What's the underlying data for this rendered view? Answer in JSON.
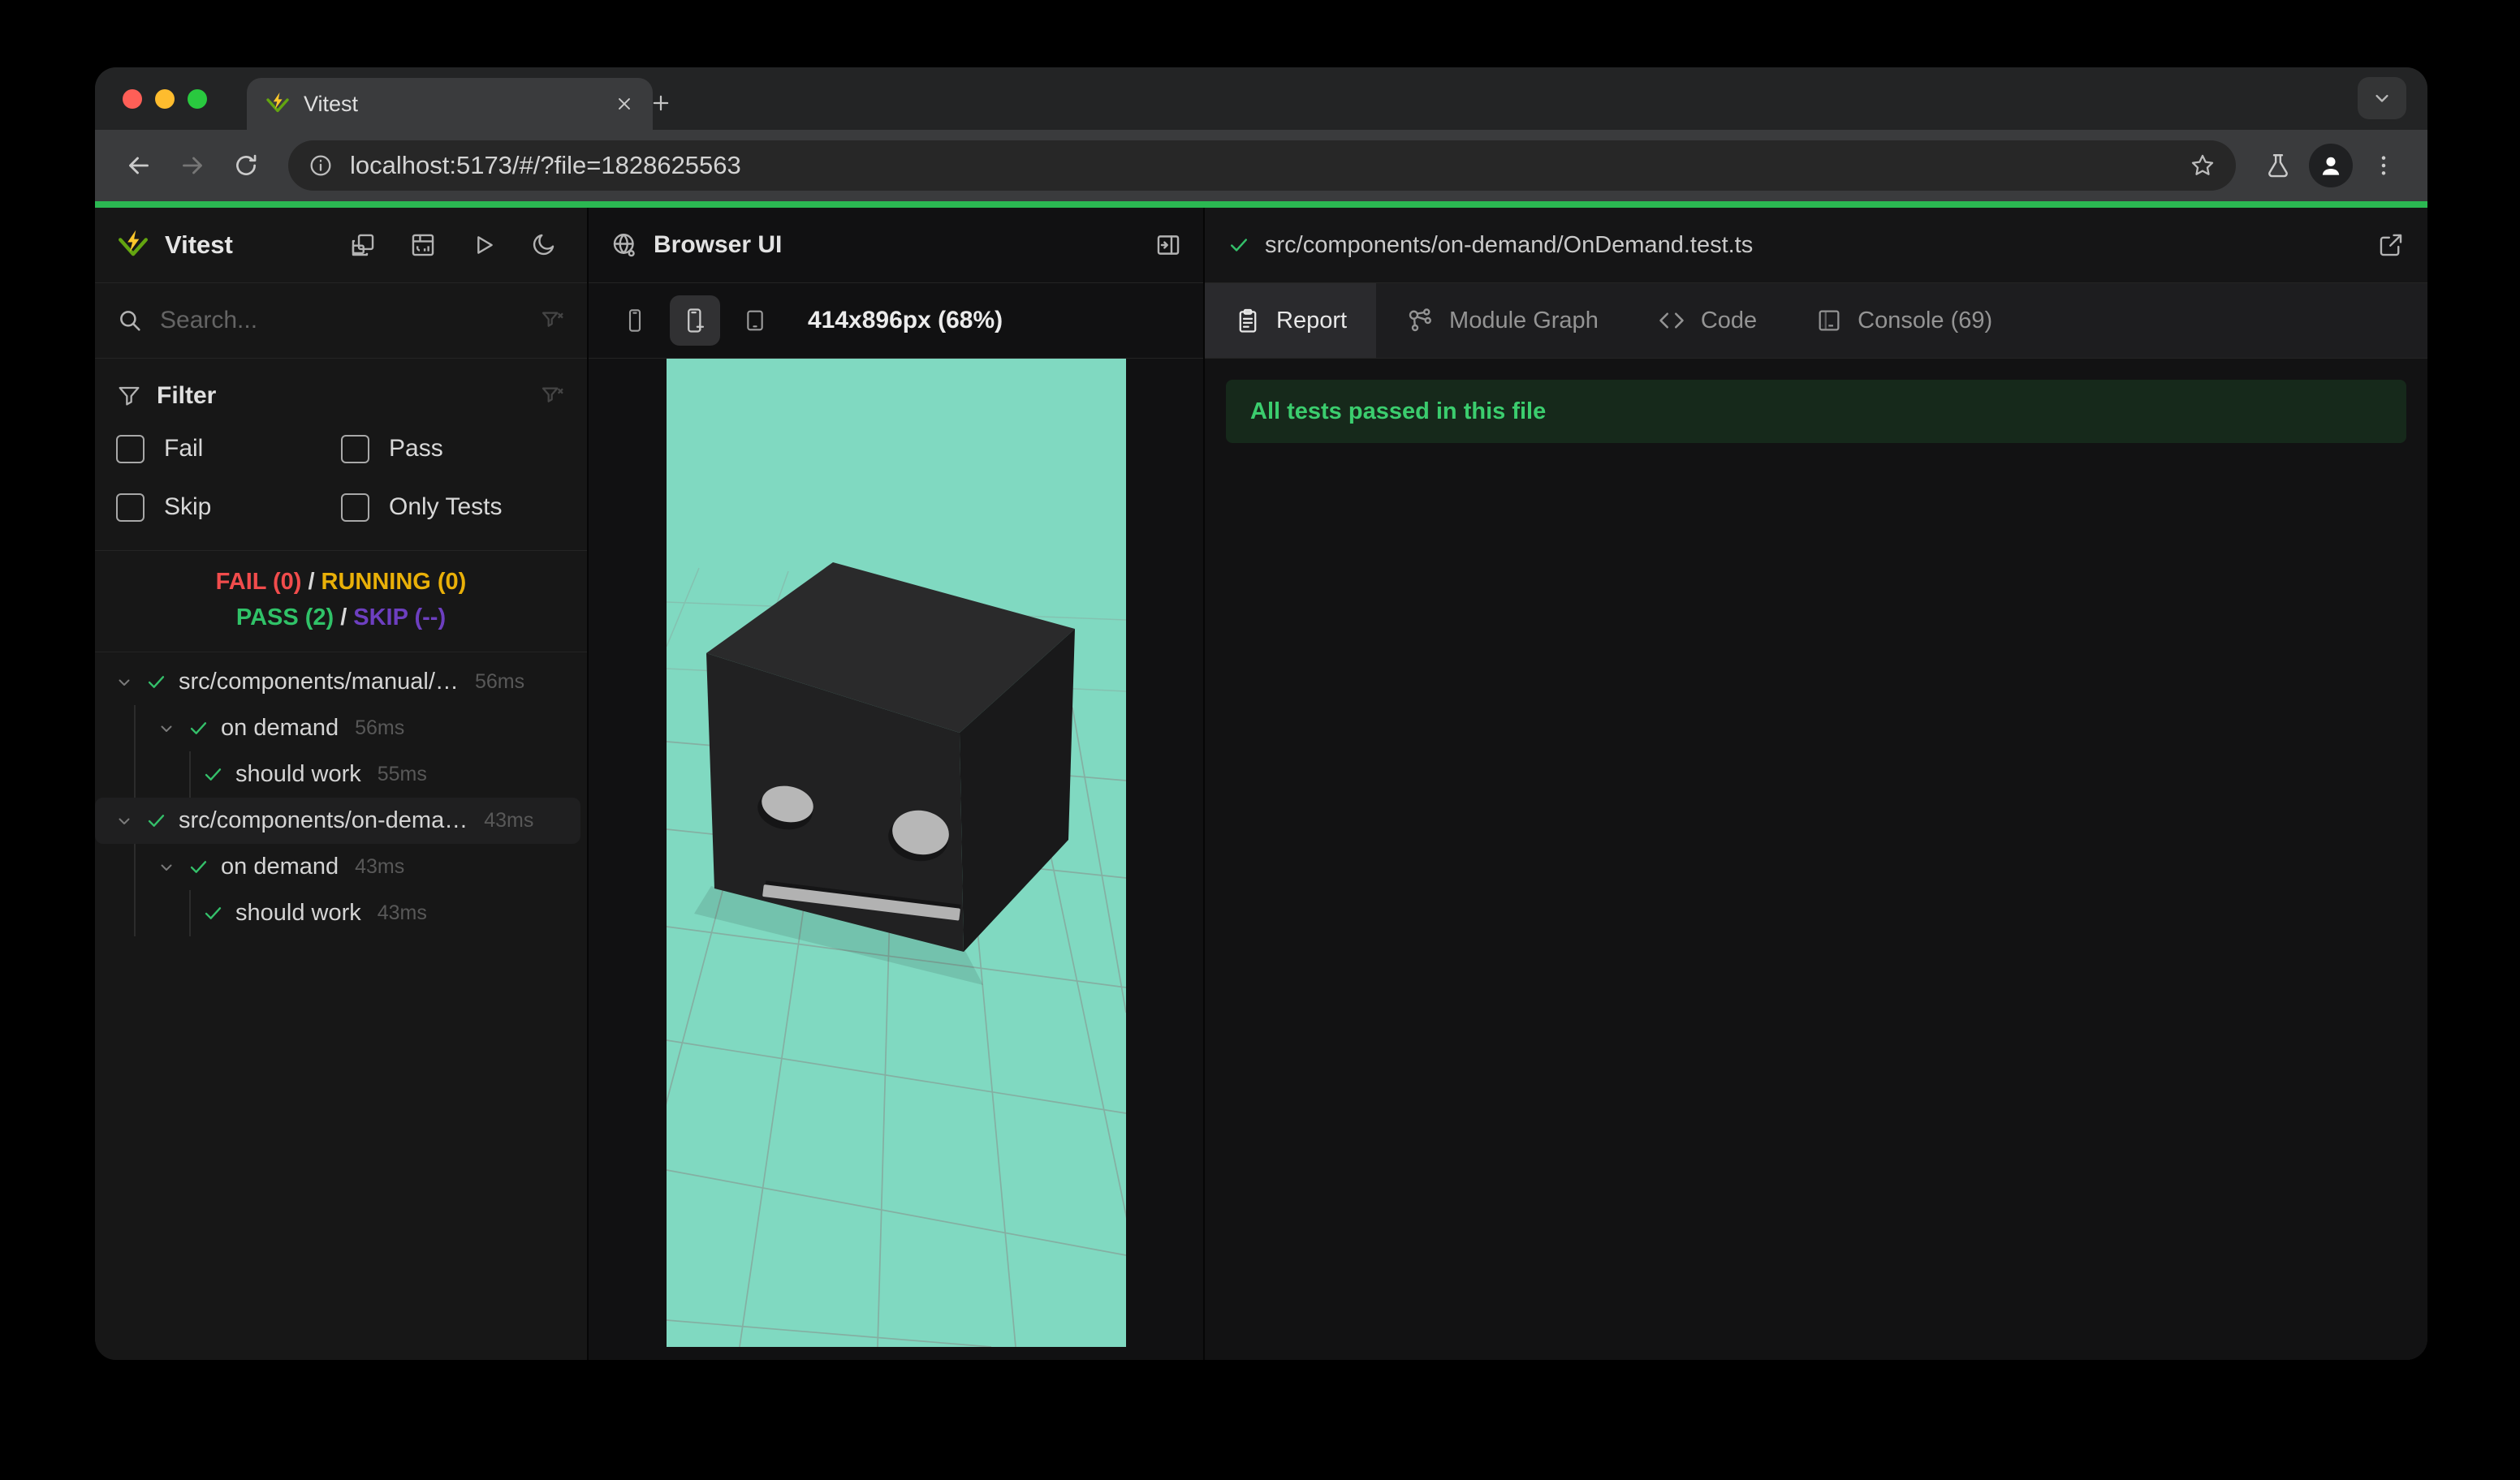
{
  "browser": {
    "tab": {
      "title": "Vitest"
    },
    "url": "localhost:5173/#/?file=1828625563"
  },
  "sidebar": {
    "app_title": "Vitest",
    "search": {
      "placeholder": "Search..."
    },
    "filter": {
      "title": "Filter",
      "options": [
        {
          "label": "Fail",
          "checked": false
        },
        {
          "label": "Pass",
          "checked": false
        },
        {
          "label": "Skip",
          "checked": false
        },
        {
          "label": "Only Tests",
          "checked": false
        }
      ]
    },
    "summary": {
      "fail": "FAIL (0)",
      "sep1": "/",
      "running": "RUNNING (0)",
      "pass": "PASS (2)",
      "sep2": "/",
      "skip": "SKIP (--)"
    },
    "tree": [
      {
        "label": "src/components/manual/…",
        "duration": "56ms",
        "depth": 0,
        "expandable": true,
        "status": "pass",
        "selected": false
      },
      {
        "label": "on demand",
        "duration": "56ms",
        "depth": 1,
        "expandable": true,
        "status": "pass",
        "selected": false
      },
      {
        "label": "should work",
        "duration": "55ms",
        "depth": 2,
        "expandable": false,
        "status": "pass",
        "selected": false
      },
      {
        "label": "src/components/on-dema…",
        "duration": "43ms",
        "depth": 0,
        "expandable": true,
        "status": "pass",
        "selected": true
      },
      {
        "label": "on demand",
        "duration": "43ms",
        "depth": 1,
        "expandable": true,
        "status": "pass",
        "selected": false
      },
      {
        "label": "should work",
        "duration": "43ms",
        "depth": 2,
        "expandable": false,
        "status": "pass",
        "selected": false
      }
    ]
  },
  "preview": {
    "title": "Browser UI",
    "viewport_label": "414x896px (68%)",
    "devices": [
      {
        "icon": "phone-icon",
        "active": false
      },
      {
        "icon": "phone-plus-icon",
        "active": true
      },
      {
        "icon": "tablet-minus-icon",
        "active": false
      }
    ]
  },
  "report": {
    "file_path": "src/components/on-demand/OnDemand.test.ts",
    "tabs": [
      {
        "label": "Report",
        "icon": "report-icon",
        "active": true
      },
      {
        "label": "Module Graph",
        "icon": "module-graph-icon",
        "active": false
      },
      {
        "label": "Code",
        "icon": "code-icon",
        "active": false
      },
      {
        "label": "Console (69)",
        "icon": "console-icon",
        "active": false
      }
    ],
    "banner": "All tests passed in this file"
  },
  "colors": {
    "progress_bar": "#2bb852",
    "pass": "#30c268",
    "fail": "#f14c4c",
    "running": "#e9b008",
    "skip": "#6d3fc0",
    "check": "#34c06a",
    "preview_canvas": "#80d9c1",
    "banner_bg": "#16291b",
    "banner_text": "#3bcd6e",
    "traffic_red": "#ff5f57",
    "traffic_yellow": "#febc2e",
    "traffic_green": "#29c93f"
  }
}
